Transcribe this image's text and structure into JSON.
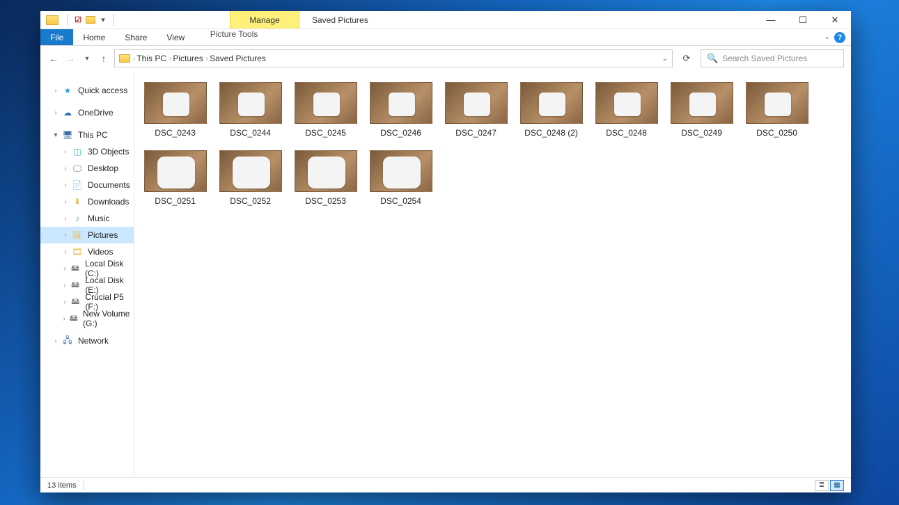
{
  "titlebar": {
    "manage_label": "Manage",
    "window_title": "Saved Pictures"
  },
  "tabs": {
    "file": "File",
    "home": "Home",
    "share": "Share",
    "view": "View",
    "context": "Picture Tools"
  },
  "breadcrumb": {
    "items": [
      "This PC",
      "Pictures",
      "Saved Pictures"
    ]
  },
  "search": {
    "placeholder": "Search Saved Pictures"
  },
  "sidebar": {
    "quick_access": "Quick access",
    "onedrive": "OneDrive",
    "this_pc": "This PC",
    "children": [
      "3D Objects",
      "Desktop",
      "Documents",
      "Downloads",
      "Music",
      "Pictures",
      "Videos",
      "Local Disk (C:)",
      "Local Disk (E:)",
      "Crucial P5 (F:)",
      "New Volume (G:)"
    ],
    "network": "Network"
  },
  "files": [
    {
      "name": "DSC_0243",
      "big": false
    },
    {
      "name": "DSC_0244",
      "big": false
    },
    {
      "name": "DSC_0245",
      "big": false
    },
    {
      "name": "DSC_0246",
      "big": false
    },
    {
      "name": "DSC_0247",
      "big": false
    },
    {
      "name": "DSC_0248 (2)",
      "big": false
    },
    {
      "name": "DSC_0248",
      "big": false
    },
    {
      "name": "DSC_0249",
      "big": false
    },
    {
      "name": "DSC_0250",
      "big": false
    },
    {
      "name": "DSC_0251",
      "big": true
    },
    {
      "name": "DSC_0252",
      "big": true
    },
    {
      "name": "DSC_0253",
      "big": true
    },
    {
      "name": "DSC_0254",
      "big": true
    }
  ],
  "status": {
    "item_count": "13 items"
  }
}
